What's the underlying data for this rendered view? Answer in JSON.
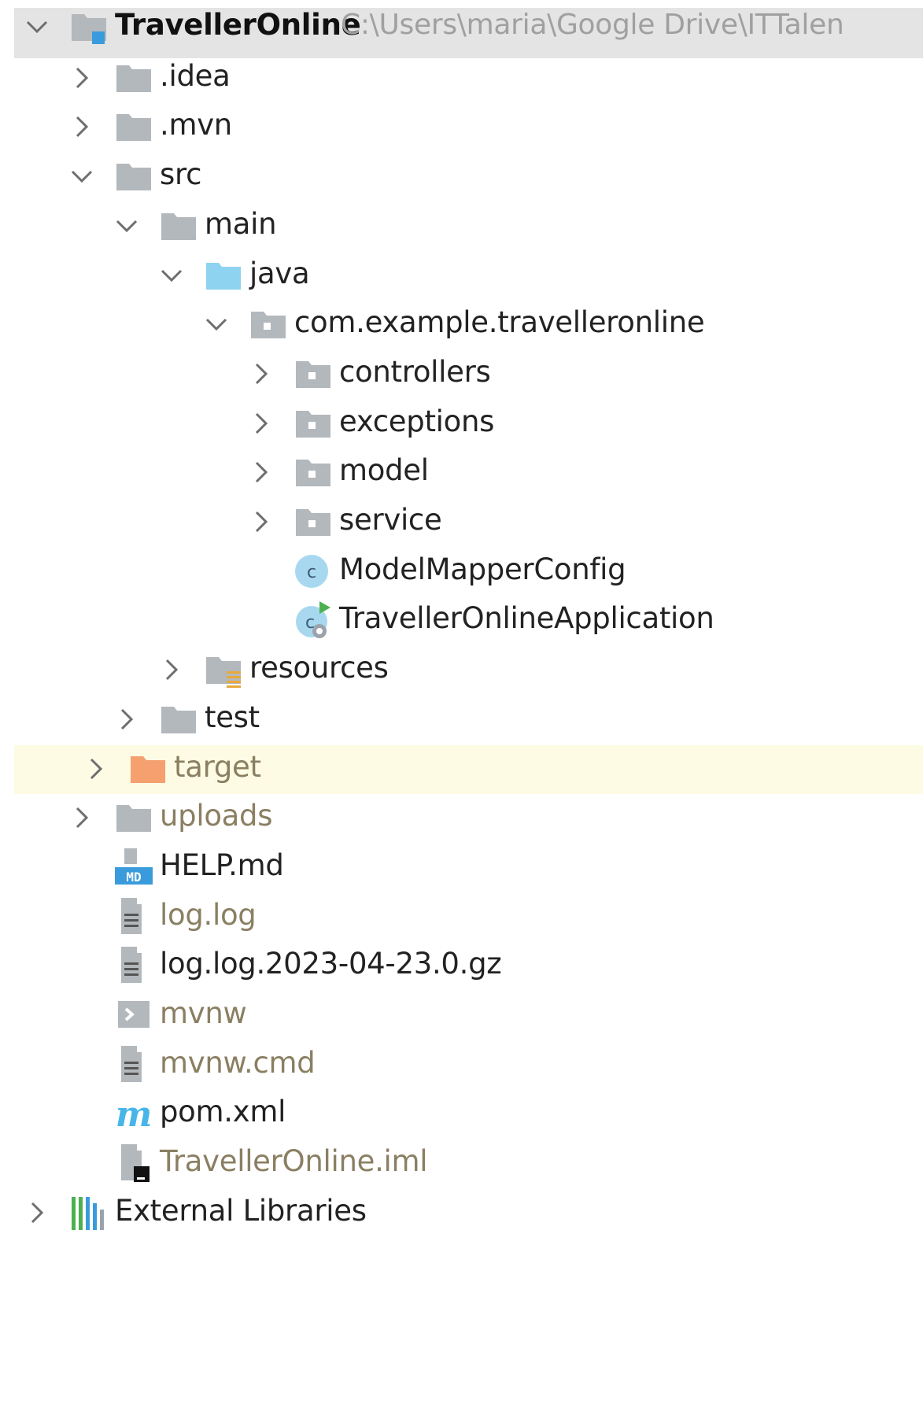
{
  "project": {
    "name": "TravellerOnline",
    "path": "C:\\Users\\maria\\Google Drive\\ITTalen"
  },
  "tree": [
    {
      "label": "TravellerOnline",
      "depth": 0,
      "state": "expanded",
      "icon": "module-folder-icon",
      "kind": "root",
      "muted": false
    },
    {
      "label": ".idea",
      "depth": 1,
      "state": "collapsed",
      "icon": "folder-icon",
      "muted": false
    },
    {
      "label": ".mvn",
      "depth": 1,
      "state": "collapsed",
      "icon": "folder-icon",
      "muted": false
    },
    {
      "label": "src",
      "depth": 1,
      "state": "expanded",
      "icon": "folder-icon",
      "muted": false
    },
    {
      "label": "main",
      "depth": 2,
      "state": "expanded",
      "icon": "folder-icon",
      "muted": false
    },
    {
      "label": "java",
      "depth": 3,
      "state": "expanded",
      "icon": "source-folder-icon",
      "muted": false
    },
    {
      "label": "com.example.travelleronline",
      "depth": 4,
      "state": "expanded",
      "icon": "package-icon",
      "muted": false
    },
    {
      "label": "controllers",
      "depth": 5,
      "state": "collapsed",
      "icon": "package-icon",
      "muted": false
    },
    {
      "label": "exceptions",
      "depth": 5,
      "state": "collapsed",
      "icon": "package-icon",
      "muted": false
    },
    {
      "label": "model",
      "depth": 5,
      "state": "collapsed",
      "icon": "package-icon",
      "muted": false
    },
    {
      "label": "service",
      "depth": 5,
      "state": "collapsed",
      "icon": "package-icon",
      "muted": false
    },
    {
      "label": "ModelMapperConfig",
      "depth": 5,
      "state": "leaf",
      "icon": "java-class-icon",
      "muted": false
    },
    {
      "label": "TravellerOnlineApplication",
      "depth": 5,
      "state": "leaf",
      "icon": "spring-boot-class-icon",
      "muted": false
    },
    {
      "label": "resources",
      "depth": 3,
      "state": "collapsed",
      "icon": "resources-folder-icon",
      "muted": false
    },
    {
      "label": "test",
      "depth": 2,
      "state": "collapsed",
      "icon": "folder-icon",
      "muted": false
    },
    {
      "label": "target",
      "depth": 1,
      "state": "collapsed",
      "icon": "excluded-folder-icon",
      "muted": true,
      "selected": true
    },
    {
      "label": "uploads",
      "depth": 1,
      "state": "collapsed",
      "icon": "folder-icon",
      "muted": true
    },
    {
      "label": "HELP.md",
      "depth": 1,
      "state": "leaf",
      "icon": "markdown-file-icon",
      "muted": false
    },
    {
      "label": "log.log",
      "depth": 1,
      "state": "leaf",
      "icon": "text-file-icon",
      "muted": true
    },
    {
      "label": "log.log.2023-04-23.0.gz",
      "depth": 1,
      "state": "leaf",
      "icon": "text-file-icon",
      "muted": false
    },
    {
      "label": "mvnw",
      "depth": 1,
      "state": "leaf",
      "icon": "shell-script-icon",
      "muted": true
    },
    {
      "label": "mvnw.cmd",
      "depth": 1,
      "state": "leaf",
      "icon": "text-file-icon",
      "muted": true
    },
    {
      "label": "pom.xml",
      "depth": 1,
      "state": "leaf",
      "icon": "maven-icon",
      "muted": false
    },
    {
      "label": "TravellerOnline.iml",
      "depth": 1,
      "state": "leaf",
      "icon": "iml-file-icon",
      "muted": true
    },
    {
      "label": "External Libraries",
      "depth": 0,
      "state": "collapsed",
      "icon": "libraries-icon",
      "muted": false
    }
  ],
  "colors": {
    "root_row_bg": "#e4e4e4",
    "selected_row_bg": "#fdfbe3",
    "folder_gray": "#b3b8bd",
    "source_folder_blue": "#8ed3ef",
    "excluded_folder_orange": "#f5a06e",
    "java_class_blue": "#a7d8ef",
    "spring_green": "#4cb050",
    "maven_blue": "#47b5e8",
    "muted_text": "#8a7f62"
  }
}
